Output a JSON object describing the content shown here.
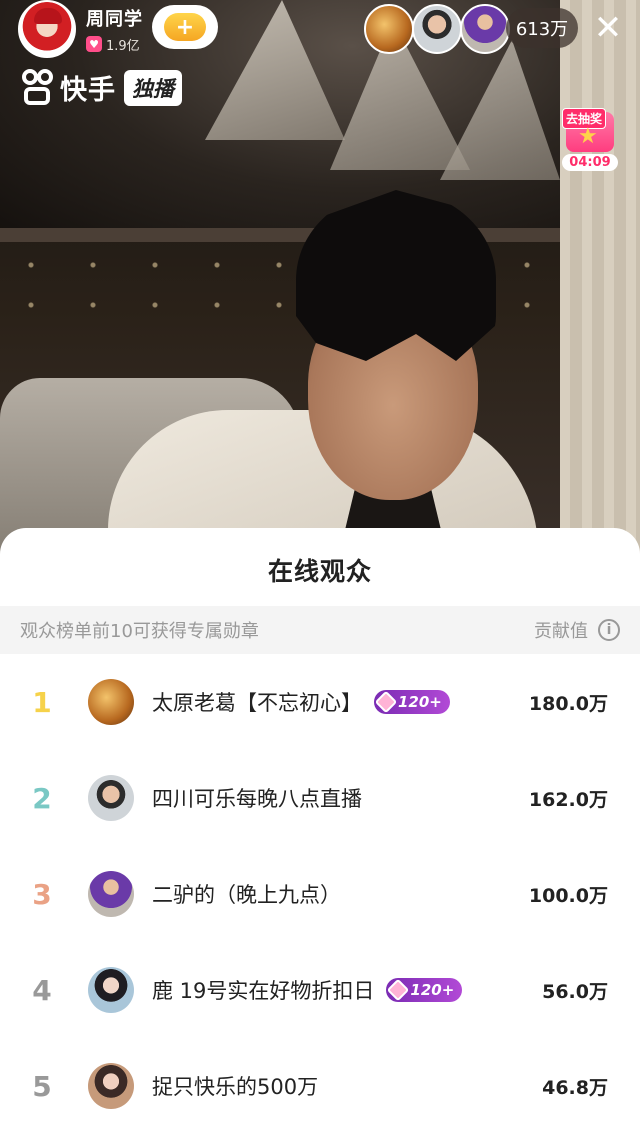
{
  "host": {
    "name": "周同学",
    "likes": "1.9亿"
  },
  "brand": {
    "name": "快手",
    "exclusive": "独播"
  },
  "viewer_count": "613万",
  "lottery": {
    "label": "去抽奖",
    "countdown": "04:09"
  },
  "sheet": {
    "title": "在线观众",
    "hint": "观众榜单前10可获得专属勋章",
    "contribution_label": "贡献值"
  },
  "ranking": [
    {
      "rank": "1",
      "name": "太原老葛【不忘初心】",
      "badge": "120+",
      "score": "180.0万"
    },
    {
      "rank": "2",
      "name": "四川可乐每晚八点直播",
      "badge": "",
      "score": "162.0万"
    },
    {
      "rank": "3",
      "name": "二驴的（晚上九点）",
      "badge": "",
      "score": "100.0万"
    },
    {
      "rank": "4",
      "name": "鹿 19号实在好物折扣日",
      "badge": "120+",
      "score": "56.0万"
    },
    {
      "rank": "5",
      "name": "捉只快乐的500万",
      "badge": "",
      "score": "46.8万"
    }
  ],
  "colors": {
    "rank1": "#f6d24a",
    "rank2": "#7ac8c4",
    "rank3": "#eaa285",
    "badge": "#7a2bb3",
    "accent": "#ff2d6a"
  }
}
